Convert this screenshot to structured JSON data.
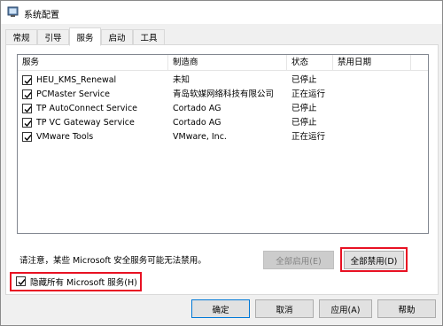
{
  "window": {
    "title": "系统配置"
  },
  "tabs": [
    {
      "label": "常规"
    },
    {
      "label": "引导"
    },
    {
      "label": "服务"
    },
    {
      "label": "启动"
    },
    {
      "label": "工具"
    }
  ],
  "services_table": {
    "columns": [
      "服务",
      "制造商",
      "状态",
      "禁用日期"
    ],
    "rows": [
      {
        "checked": true,
        "service": "HEU_KMS_Renewal",
        "manufacturer": "未知",
        "status": "已停止",
        "disabled_date": ""
      },
      {
        "checked": true,
        "service": "PCMaster Service",
        "manufacturer": "青岛软媒网络科技有限公司",
        "status": "正在运行",
        "disabled_date": ""
      },
      {
        "checked": true,
        "service": "TP AutoConnect Service",
        "manufacturer": "Cortado AG",
        "status": "已停止",
        "disabled_date": ""
      },
      {
        "checked": true,
        "service": "TP VC Gateway Service",
        "manufacturer": "Cortado AG",
        "status": "已停止",
        "disabled_date": ""
      },
      {
        "checked": true,
        "service": "VMware Tools",
        "manufacturer": "VMware, Inc.",
        "status": "正在运行",
        "disabled_date": ""
      }
    ]
  },
  "note": "请注意，某些 Microsoft 安全服务可能无法禁用。",
  "buttons": {
    "enable_all": "全部启用(E)",
    "disable_all": "全部禁用(D)",
    "ok": "确定",
    "cancel": "取消",
    "apply": "应用(A)",
    "help": "帮助"
  },
  "hide_ms": {
    "label": "隐藏所有 Microsoft 服务(H)",
    "checked": true
  },
  "colors": {
    "highlight": "#e81123",
    "accent": "#0078d7"
  }
}
